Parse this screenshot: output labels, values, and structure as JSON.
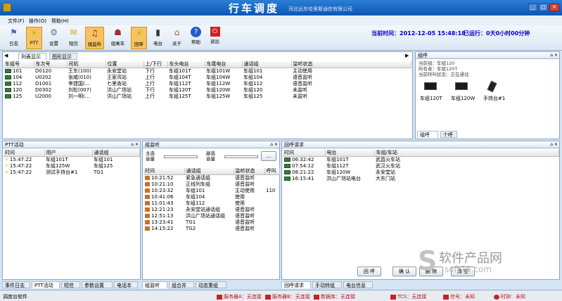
{
  "title": {
    "main": "行车调度",
    "company": "河北远东哈里斯通信有限公司"
  },
  "menu": [
    "文件(F)",
    "操作(O)",
    "帮助(H)"
  ],
  "toolbar": [
    {
      "label": "日志",
      "icon": "log-icon"
    },
    {
      "label": "PTT",
      "icon": "lightning-icon"
    },
    {
      "label": "设置",
      "icon": "gear-icon"
    },
    {
      "label": "短信",
      "icon": "envelope-icon"
    },
    {
      "label": "组监听",
      "icon": "group-monitor-icon"
    },
    {
      "label": "组乘车",
      "icon": "group-ride-icon"
    },
    {
      "label": "回呼",
      "icon": "callback-icon"
    },
    {
      "label": "电台",
      "icon": "radio-icon"
    },
    {
      "label": "关于",
      "icon": "home-icon"
    },
    {
      "label": "帮助",
      "icon": "help-icon"
    },
    {
      "label": "退出",
      "icon": "exit-icon"
    }
  ],
  "header": {
    "time_label": "当前时间：2012-12-05 15:48:18",
    "run_label": "已运行：0天0小时00分钟"
  },
  "main_tabs": [
    "列表显示",
    "图形显示"
  ],
  "train_table": {
    "columns": [
      "车组号",
      "车次号",
      "司机",
      "位置",
      "上/下行",
      "车头电台",
      "车尾电台",
      "通话组",
      "监听状态"
    ],
    "rows": [
      [
        "101",
        "D0120",
        "王东(100)",
        "永安堂站",
        "下行",
        "车组101T",
        "车组101W",
        "车组101",
        "主动使用"
      ],
      [
        "104",
        "U0202",
        "张威(010)",
        "王家湾站",
        "上行",
        "车组104T",
        "车组104W",
        "车组104",
        "语音监听"
      ],
      [
        "112",
        "D1001",
        "李建国(...",
        "七里香站",
        "上行",
        "车组112T",
        "车组112W",
        "车组112",
        "语音监听"
      ],
      [
        "120",
        "D0302",
        "刘松(007)",
        "洪山广场站",
        "下行",
        "车组120T",
        "车组120W",
        "车组120",
        "未监听"
      ],
      [
        "125",
        "U2000",
        "刘一明(...",
        "洪山广场站",
        "上行",
        "车组125T",
        "车组125W",
        "车组125",
        "未监听"
      ]
    ]
  },
  "group_panel": {
    "title": "组呼",
    "current": "当前组：车组120",
    "owner": "所有者：车组120T",
    "last_call": "当前呼叫状态：正在通话",
    "devices": [
      "车组120T",
      "车组120W",
      "手持台#1"
    ],
    "tabs": [
      "组呼",
      "个呼"
    ]
  },
  "ptt_panel": {
    "title": "PTT活动",
    "columns": [
      "时间",
      "用户",
      "通话组"
    ],
    "rows": [
      [
        "15:47:22",
        "车组101T",
        "车组101"
      ],
      [
        "15:47:22",
        "车组125W",
        "车组125"
      ],
      [
        "15:47:22",
        "测试手持台#1",
        "TG1"
      ]
    ]
  },
  "monitor_panel": {
    "title": "组监听",
    "main_label": "主选音量",
    "sub_label": "副选音量",
    "more_btn": "...",
    "columns": [
      "时间",
      "通话组",
      "监听状态",
      "呼叫"
    ],
    "rows": [
      [
        "10:21:52",
        "紧急通话组",
        "语音监听",
        ""
      ],
      [
        "10:21:10",
        "正线列车组",
        "语音监听",
        ""
      ],
      [
        "10:23:32",
        "车组101",
        "主动使用",
        "110"
      ],
      [
        "10:41:06",
        "车组104",
        "使用",
        ""
      ],
      [
        "11:01:43",
        "车组112",
        "使用",
        ""
      ],
      [
        "12:21:23",
        "永安堂站通话组",
        "语音监听",
        ""
      ],
      [
        "12:51:13",
        "洪山广场站通话组",
        "语音监听",
        ""
      ],
      [
        "13:23:41",
        "TG1",
        "语音监听",
        ""
      ],
      [
        "14:15:22",
        "TG2",
        "语音监听",
        ""
      ]
    ]
  },
  "callback_panel": {
    "title": "回呼请求",
    "columns": [
      "时间",
      "电台",
      "车组/车站"
    ],
    "rows": [
      [
        "06:32:42",
        "车组101T",
        "武昌火车站"
      ],
      [
        "07:54:12",
        "车组112T",
        "武汉火车站"
      ],
      [
        "08:21:22",
        "车组120W",
        "永安堂站"
      ],
      [
        "16:15:41",
        "洪山广场站电台",
        "大东门站"
      ]
    ],
    "buttons": [
      "回 呼",
      "确 认",
      "删 除",
      "清 空"
    ]
  },
  "bottom_tabs_left": [
    "事件日志",
    "PTT活动",
    "短信",
    "参数设置",
    "电话本"
  ],
  "bottom_tabs_mid": [
    "组监听",
    "组合并",
    "动态重组"
  ],
  "bottom_tabs_right": [
    "回呼请求",
    "手动转组",
    "电台信息"
  ],
  "status": {
    "app": "调度台软件",
    "server_a": "服务器A：无连接",
    "server_b": "服务器B：无连接",
    "db": "数据库：无连接",
    "tcs": "TCS：无连接",
    "signal": "信号：未知",
    "clock": "时钟：未知"
  },
  "watermark": {
    "text": "软件产品网",
    "url": "soft78.com"
  }
}
